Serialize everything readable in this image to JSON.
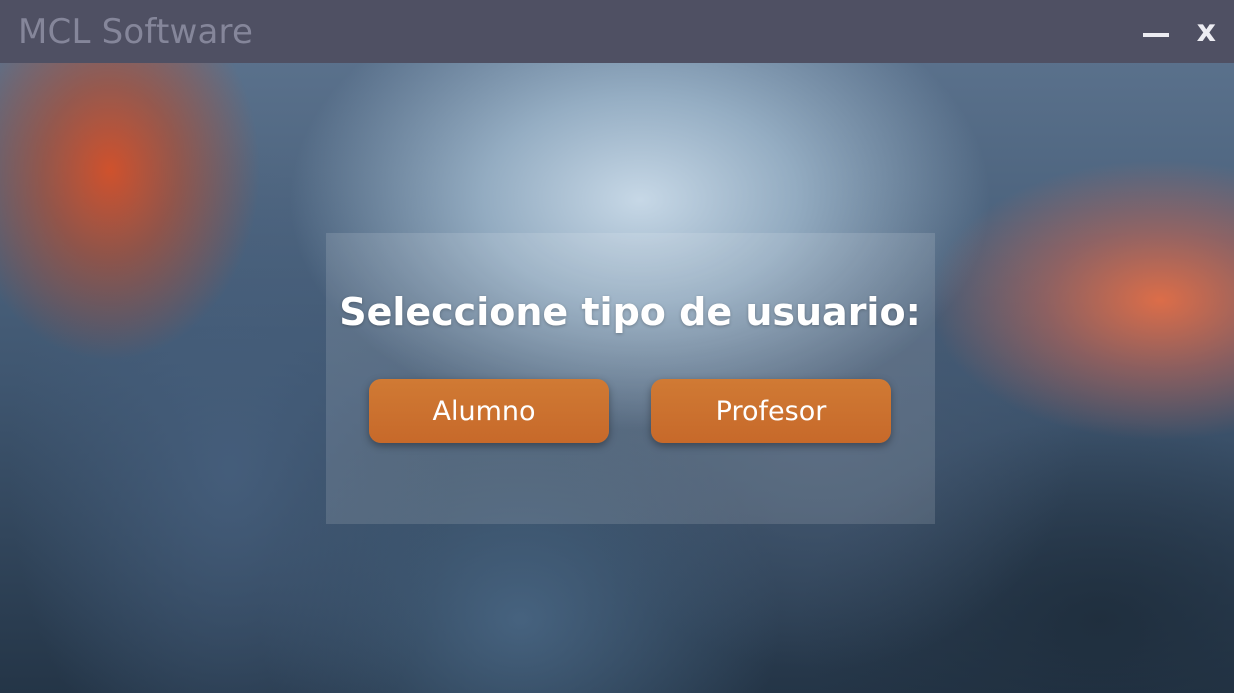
{
  "window": {
    "title": "MCL Software",
    "minimize_label": "_",
    "close_label": "x"
  },
  "dialog": {
    "heading": "Seleccione tipo de usuario:",
    "buttons": {
      "student": "Alumno",
      "teacher": "Profesor"
    }
  },
  "colors": {
    "titlebar": "#4f5063",
    "button": "#c96d2c",
    "heading": "#ffffff"
  }
}
